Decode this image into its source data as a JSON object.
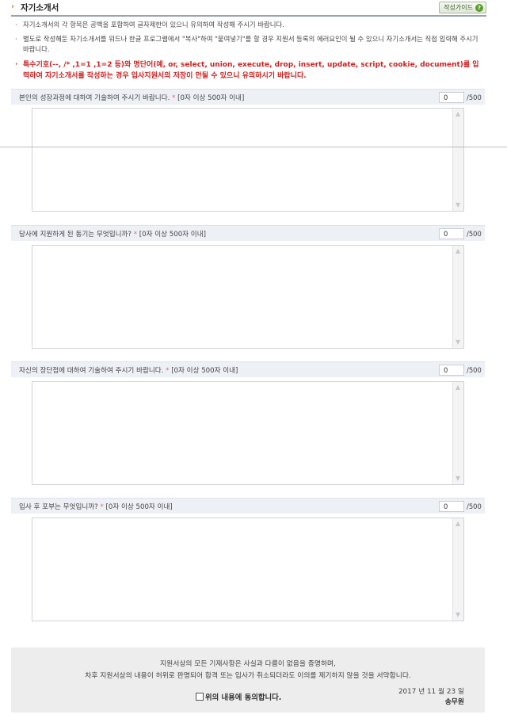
{
  "header": {
    "arrow": "›",
    "title": "자기소개서",
    "guide_label": "작성가이드",
    "guide_icon": "question-icon"
  },
  "notices": [
    {
      "bullet": "·",
      "text": "자기소개서의 각 항목은 공백을 포함하여 글자제한이 있으니 유의하여 작성해 주시기 바랍니다."
    },
    {
      "bullet": "·",
      "text": "별도로 작성해둔 자기소개서를 워드나 한글 프로그램에서 \"복사\"하여 \"붙여넣기\"를 할 경우 지원서 등록의 에러요인이 될 수 있으니 자기소개서는 직접 입력해 주시기 바랍니다."
    },
    {
      "bullet": "·",
      "text": "특수기호(--, /* ,1=1 ,1=2 등)와 명단어(예, or, select, union, execute, drop, insert, update, script, cookie, document)를 입력하여 자기소개서를 작성하는 경우 입사지원서의 저장이 안될 수 있으니 유의하시기 바랍니다."
    }
  ],
  "questions": [
    {
      "text": "본인의 성장과정에 대하여 기술하여 주시기 바랍니다.",
      "star": "*",
      "limit": "[0자 이상 500자 이내]",
      "count": "0",
      "max": "/500",
      "answer": ""
    },
    {
      "text": "당사에 지원하게 된 동기는 무엇입니까?",
      "star": "*",
      "limit": "[0자 이상 500자 이내]",
      "count": "0",
      "max": "/500",
      "answer": ""
    },
    {
      "text": "자신의 장단점에 대하여 기술하여 주시기 바랍니다.",
      "star": "*",
      "limit": "[0자 이상 500자 이내]",
      "count": "0",
      "max": "/500",
      "answer": ""
    },
    {
      "text": "입사 후 포부는 무엇입니까?",
      "star": "*",
      "limit": "[0자 이상 500자 이내]",
      "count": "0",
      "max": "/500",
      "answer": ""
    }
  ],
  "scroll": {
    "up": "▲",
    "down": "▼"
  },
  "footer": {
    "line1": "지원서상의 모든 기재사항은 사실과 다름이 없음을 증명하며,",
    "line2": "차후 지원서상의 내용이 허위로 판명되어 합격 또는 입사가 취소되더라도 이의를 제기하지 않을 것을 서약합니다.",
    "agree_label": "위의 내용에 동의합니다.",
    "date": "2017 년 11 월 23 일",
    "name": "송무원"
  }
}
